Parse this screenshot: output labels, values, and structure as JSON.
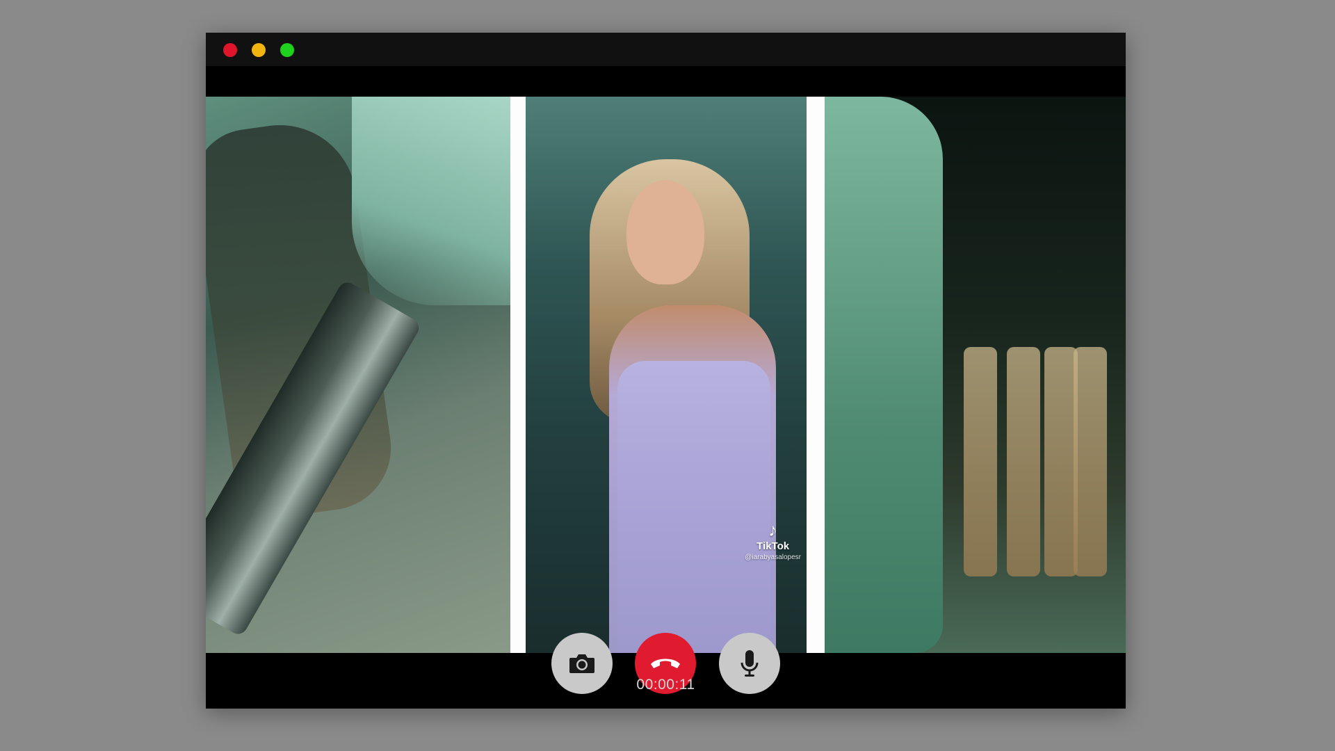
{
  "window": {
    "traffic_lights": [
      {
        "name": "close",
        "color": "#e0142a"
      },
      {
        "name": "minimize",
        "color": "#f2b411"
      },
      {
        "name": "maximize",
        "color": "#1ed21e"
      }
    ]
  },
  "call": {
    "timer": "00:00:11",
    "overlay": {
      "brand_icon": "tiktok-icon",
      "brand_label": "TikTok",
      "handle": "@iarabyasalopesr"
    },
    "controls": {
      "camera": {
        "icon": "camera-icon",
        "color": "#c9c9c9"
      },
      "hangup": {
        "icon": "phone-hangup-icon",
        "color": "#e01b2f"
      },
      "mic": {
        "icon": "microphone-icon",
        "color": "#c9c9c9"
      }
    }
  },
  "colors": {
    "background": "#8a8a8a",
    "window_bg": "#000000",
    "titlebar_bg": "#111111",
    "timer_text": "#d8d8d8"
  }
}
